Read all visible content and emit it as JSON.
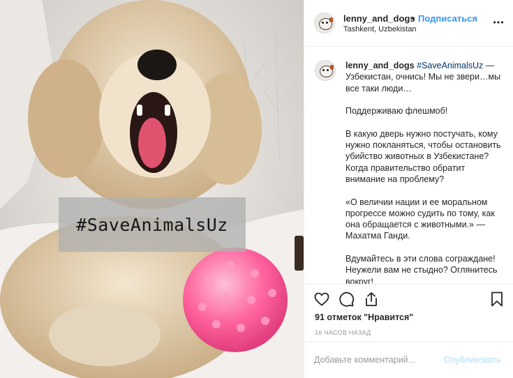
{
  "post": {
    "hashtag_overlay": "#SaveAnimalsUz"
  },
  "header": {
    "username": "lenny_and_dogs",
    "separator": "•",
    "follow_label": "Подписаться",
    "location": "Tashkent, Uzbekistan",
    "more_icon": "more-horizontal-icon"
  },
  "caption": {
    "username": "lenny_and_dogs",
    "hashtag": "#SaveAnimalsUz",
    "lines": [
      " — Узбекистан, очнись! Мы не звери…мы все таки люди…",
      "Поддерживаю флешмоб!",
      "В какую дверь нужно постучать, кому нужно покланяться, чтобы остановить убийство животных в Узбекистане? Когда правительство обратит внимание на проблему?",
      "«О величии нации и ее моральном прогрессе можно судить по тому, как она обращается с животными.» —  Махатма Ганди.",
      "Вдумайтесь в эти слова сограждане! Неужели вам не стыдно? Оглянитесь вокруг!"
    ]
  },
  "actions": {
    "like_icon": "heart-icon",
    "comment_icon": "comment-icon",
    "share_icon": "share-icon",
    "save_icon": "bookmark-icon",
    "likes_text": "91 отметок \"Нравится\"",
    "time_text": "16 ЧАСОВ НАЗАД"
  },
  "comment": {
    "placeholder": "Добавьте комментарий...",
    "publish_label": "Опубликовать"
  },
  "colors": {
    "accent": "#3897f0",
    "publish_disabled": "#b2dffc",
    "ball": "#ff5c9a"
  }
}
